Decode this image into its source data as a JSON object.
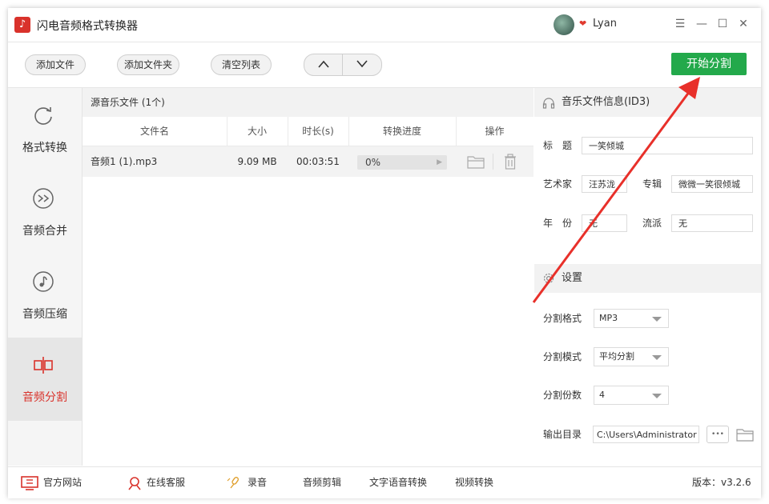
{
  "app": {
    "title": "闪电音频格式转换器",
    "username": "Lyan"
  },
  "toolbar": {
    "add_file": "添加文件",
    "add_folder": "添加文件夹",
    "clear_list": "清空列表",
    "move_up": "∧",
    "move_down": "∨",
    "start": "开始分割"
  },
  "sidebar": {
    "items": [
      {
        "label": "格式转换",
        "icon": "refresh-icon"
      },
      {
        "label": "音频合并",
        "icon": "merge-icon"
      },
      {
        "label": "音频压缩",
        "icon": "music-note-icon"
      },
      {
        "label": "音频分割",
        "icon": "split-icon",
        "active": true
      }
    ]
  },
  "filelist": {
    "title": "源音乐文件 (1个)",
    "columns": [
      "文件名",
      "大小",
      "时长(s)",
      "转换进度",
      "操作"
    ],
    "rows": [
      {
        "name": "音频1 (1).mp3",
        "size": "9.09 MB",
        "duration": "00:03:51",
        "progress": "0%",
        "progress_value": 0
      }
    ]
  },
  "music_info": {
    "header": "音乐文件信息(ID3)",
    "title_label": "标　题",
    "title_value": "一笑倾城",
    "artist_label": "艺术家",
    "artist_value": "汪苏泷",
    "album_label": "专辑",
    "album_value": "微微一笑很倾城",
    "year_label": "年　份",
    "year_value": "无",
    "genre_label": "流派",
    "genre_value": "无"
  },
  "settings": {
    "header": "设置",
    "format_label": "分割格式",
    "format_value": "MP3",
    "mode_label": "分割模式",
    "mode_value": "平均分割",
    "count_label": "分割份数",
    "count_value": "4",
    "output_label": "输出目录",
    "output_value": "C:\\Users\\Administrator",
    "more_button": "•••"
  },
  "footer": {
    "website": "官方网站",
    "service": "在线客服",
    "record": "录音",
    "audio_edit": "音频剪辑",
    "tts": "文字语音转换",
    "video": "视频转换",
    "version": "版本：v3.2.6"
  },
  "colors": {
    "accent": "#d9322b",
    "start": "#23a94b",
    "arrow": "#e8302a"
  }
}
